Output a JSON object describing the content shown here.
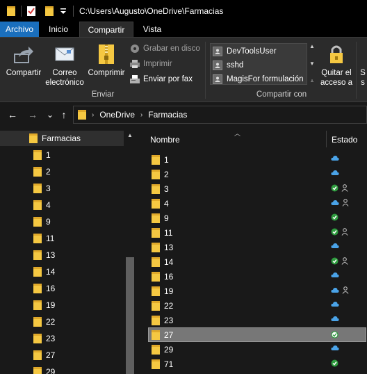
{
  "titlebar": {
    "path": "C:\\Users\\Augusto\\OneDrive\\Farmacias",
    "qa_dropdown": "="
  },
  "tabs": {
    "file": "Archivo",
    "home": "Inicio",
    "share": "Compartir",
    "view": "Vista"
  },
  "ribbon": {
    "share_button": "Compartir",
    "email_button_line1": "Correo",
    "email_button_line2": "electrónico",
    "zip_button": "Comprimir",
    "burn_disc": "Grabar en disco",
    "print": "Imprimir",
    "fax": "Enviar por fax",
    "send_group": "Enviar",
    "share_with_group": "Compartir con",
    "share_with": [
      "DevToolsUser",
      "sshd",
      "MagisFor formulación"
    ],
    "stop_sharing_line1": "Quitar el",
    "stop_sharing_line2": "acceso a",
    "advanced_cut": "S",
    "advanced_cut2": "s"
  },
  "navbar": {
    "back": "←",
    "forward": "→",
    "recent": "⌄",
    "up": "↑",
    "crumbs": [
      "OneDrive",
      "Farmacias"
    ]
  },
  "navpane": {
    "root": "Farmacias",
    "items": [
      "1",
      "2",
      "3",
      "4",
      "9",
      "11",
      "13",
      "14",
      "16",
      "19",
      "22",
      "23",
      "27",
      "29"
    ]
  },
  "filelist": {
    "col_name": "Nombre",
    "col_state": "Estado",
    "rows": [
      {
        "name": "1",
        "status": "cloud",
        "shared": false,
        "selected": false
      },
      {
        "name": "2",
        "status": "cloud",
        "shared": false,
        "selected": false
      },
      {
        "name": "3",
        "status": "check-filled",
        "shared": true,
        "selected": false
      },
      {
        "name": "4",
        "status": "cloud",
        "shared": true,
        "selected": false
      },
      {
        "name": "9",
        "status": "check-filled",
        "shared": false,
        "selected": false
      },
      {
        "name": "11",
        "status": "check-filled",
        "shared": true,
        "selected": false
      },
      {
        "name": "13",
        "status": "cloud",
        "shared": false,
        "selected": false
      },
      {
        "name": "14",
        "status": "check-filled",
        "shared": true,
        "selected": false
      },
      {
        "name": "16",
        "status": "cloud",
        "shared": false,
        "selected": false
      },
      {
        "name": "19",
        "status": "cloud",
        "shared": true,
        "selected": false
      },
      {
        "name": "22",
        "status": "cloud",
        "shared": false,
        "selected": false
      },
      {
        "name": "23",
        "status": "cloud",
        "shared": false,
        "selected": false
      },
      {
        "name": "27",
        "status": "check-outline",
        "shared": false,
        "selected": true
      },
      {
        "name": "29",
        "status": "cloud",
        "shared": false,
        "selected": false
      },
      {
        "name": "71",
        "status": "check-filled",
        "shared": false,
        "selected": false
      }
    ]
  },
  "colors": {
    "accent": "#1a6fbd",
    "folder": "#f5c842",
    "cloud": "#4aa3e8",
    "sync_ok": "#2e9b3e",
    "selected": "#777777"
  }
}
